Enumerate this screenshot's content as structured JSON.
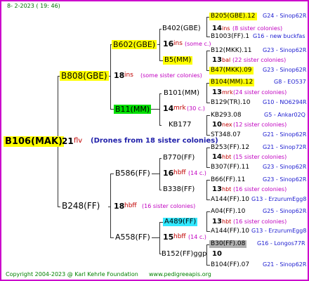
{
  "header": {
    "date_line": "8-  2-2023  ( 19: 46)"
  },
  "colors": {
    "frame": "#cc00cc",
    "yellow_hl": "#ffff00",
    "green_hl": "#00dd00",
    "cyan_hl": "#33e8ff",
    "gray_hl": "#b0b0b0"
  },
  "root": {
    "name": "B106(MAK)",
    "gen": "21",
    "lines_label": "flv",
    "drone_note": "(Drones from 18 sister colonies)"
  },
  "gen1": [
    {
      "name": "B808(GBE)",
      "num": "18",
      "code": "ins",
      "note": "(some sister colonies)"
    },
    {
      "name": "B248(FF)",
      "num": "18",
      "code": "hbff",
      "note": "(16 sister colonies)"
    }
  ],
  "gen2": [
    {
      "name": "B602(GBE)",
      "num": "16",
      "code": "ins",
      "note": "(some c.)"
    },
    {
      "name": "B11(MM)",
      "num": "14",
      "code": "mrk",
      "note": "(30 c.)"
    },
    {
      "name": "B586(FF)",
      "num": "16",
      "code": "hbff",
      "note": "(14 c.)"
    },
    {
      "name": "A558(FF)",
      "num": "15",
      "code": "hbff",
      "note": "(14 c.)"
    }
  ],
  "gen3": [
    {
      "name": "B402(GBE)",
      "num": "14",
      "code": "ins",
      "note": "(8 sister colonies)"
    },
    {
      "name": "B5(MM)",
      "num": "13",
      "code": "bal",
      "note": "(22 sister colonies)"
    },
    {
      "name": "B101(MM)",
      "num": "13",
      "code": "mrk",
      "note": "(24 sister colonies)"
    },
    {
      "name": "KB177",
      "num": "10",
      "code": "nex",
      "note": "(12 sister colonies)"
    },
    {
      "name": "B770(FF)",
      "num": "14",
      "code": "hbt",
      "note": "(15 sister colonies)"
    },
    {
      "name": "B338(FF)",
      "num": "13",
      "code": "hbt",
      "note": "(16 sister colonies)"
    },
    {
      "name": "A489(FF)",
      "num": "13",
      "code": "hbt",
      "note": "(16 sister colonies)"
    },
    {
      "name": "B152(FF)ggp",
      "num": "10",
      "code": "",
      "note": ""
    }
  ],
  "gen4": [
    {
      "name": "B205(GBE).12",
      "ref": "G24 - Sinop62R"
    },
    {
      "name": "B1003(FF).1",
      "ref": "G16 - new buckfas"
    },
    {
      "name": "B12(MKK).11",
      "ref": "G23 - Sinop62R"
    },
    {
      "name": "B47(MKK).09",
      "ref": "G23 - Sinop62R"
    },
    {
      "name": "B104(MM).12",
      "ref": "G8 - EO537"
    },
    {
      "name": "B129(TR).10",
      "ref": "G10 - NO6294R"
    },
    {
      "name": "KB293.08",
      "ref": "G5 - Ankar02Q"
    },
    {
      "name": "ST348.07",
      "ref": "G21 - Sinop62R"
    },
    {
      "name": "B253(FF).12",
      "ref": "G21 - Sinop72R"
    },
    {
      "name": "B307(FF).11",
      "ref": "G23 - Sinop62R"
    },
    {
      "name": "B66(FF).11",
      "ref": "G23 - Sinop62R"
    },
    {
      "name": "A144(FF).10",
      "ref": "G13 - ErzurumEgg8"
    },
    {
      "name": "A04(FF).10",
      "ref": "G25 - Sinop62R"
    },
    {
      "name": "A144(FF).10",
      "ref": "G13 - ErzurumEgg8"
    },
    {
      "name": "B30(FF).08",
      "ref": "G16 - Longos77R"
    },
    {
      "name": "B104(FF).07",
      "ref": "G21 - Sinop62R"
    }
  ],
  "footer": {
    "copyright": "Copyright 2004-2023 @ Karl Kehrle Foundation",
    "site": "www.pedigreeapis.org"
  }
}
